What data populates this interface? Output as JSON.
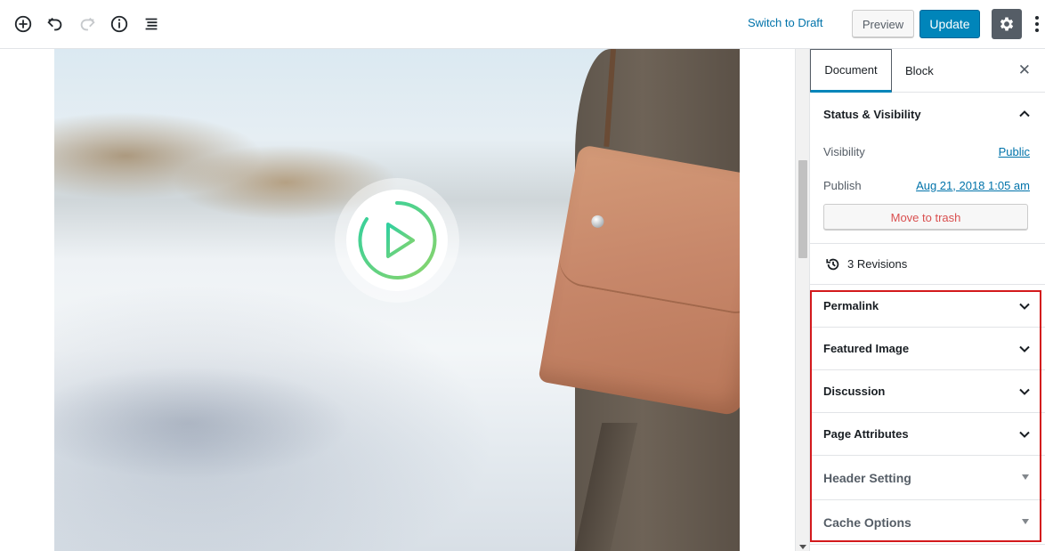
{
  "toolbar": {
    "icons": [
      "add-block-icon",
      "undo-icon",
      "redo-icon",
      "info-icon",
      "outline-icon"
    ],
    "switch_to_draft": "Switch to Draft",
    "preview": "Preview",
    "update": "Update",
    "settings_icon": "gear-icon",
    "more_icon": "more-vertical-icon"
  },
  "sidebar": {
    "tabs": [
      "Document",
      "Block"
    ],
    "active_tab": "Document",
    "status": {
      "title": "Status & Visibility",
      "visibility_label": "Visibility",
      "visibility_value": "Public",
      "publish_label": "Publish",
      "publish_value": "Aug 21, 2018 1:05 am",
      "trash_label": "Move to trash"
    },
    "revisions": "3 Revisions",
    "panels": [
      "Permalink",
      "Featured Image",
      "Discussion",
      "Page Attributes"
    ],
    "meta_boxes": [
      "Header Setting",
      "Cache Options"
    ]
  },
  "colors": {
    "accent": "#0085ba",
    "link": "#0073aa",
    "highlight": "#d3191c",
    "trash": "#d94f4f",
    "play_gradient_start": "#2fd0a0",
    "play_gradient_end": "#8bd46a"
  }
}
